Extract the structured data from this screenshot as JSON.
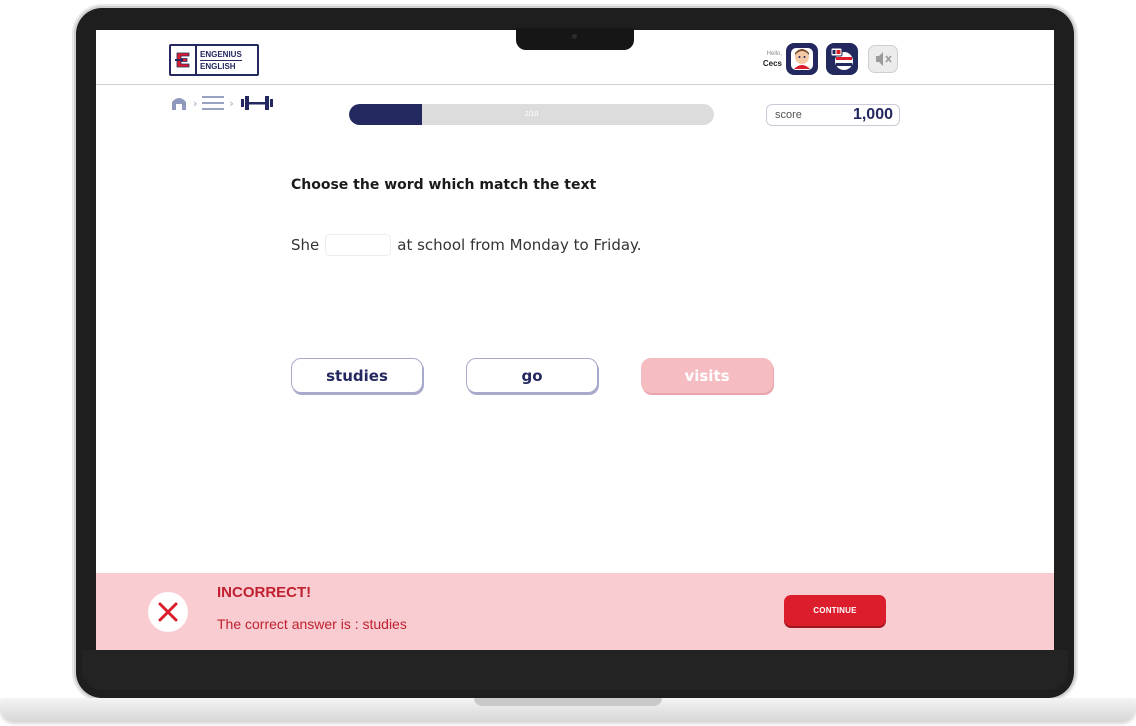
{
  "header": {
    "logo_line1": "ENGENIUS",
    "logo_line2": "ENGLISH",
    "greeting": "Hello,",
    "user_name": "Cecs"
  },
  "breadcrumb": {
    "items": [
      "home-icon",
      "menu-icon",
      "dumbbell-icon"
    ],
    "separator": "›"
  },
  "progress": {
    "label": "2/10",
    "fraction": 0.2
  },
  "score": {
    "label": "score",
    "value": "1,000"
  },
  "question": {
    "title": "Choose the word which match the text",
    "sentence_before": "She",
    "sentence_after": "at school from Monday to Friday."
  },
  "choices": [
    {
      "label": "studies",
      "state": "normal"
    },
    {
      "label": "go",
      "state": "normal"
    },
    {
      "label": "visits",
      "state": "incorrect-selected"
    }
  ],
  "feedback": {
    "title": "INCORRECT!",
    "detail": "The correct answer is : studies",
    "continue_label": "CONTINUE",
    "icon": "x-circle-icon"
  },
  "colors": {
    "brand_navy": "#23285f",
    "error_red": "#dc1e2c",
    "error_bg": "#f8ccd1",
    "wrong_choice": "#f5bcc2"
  }
}
